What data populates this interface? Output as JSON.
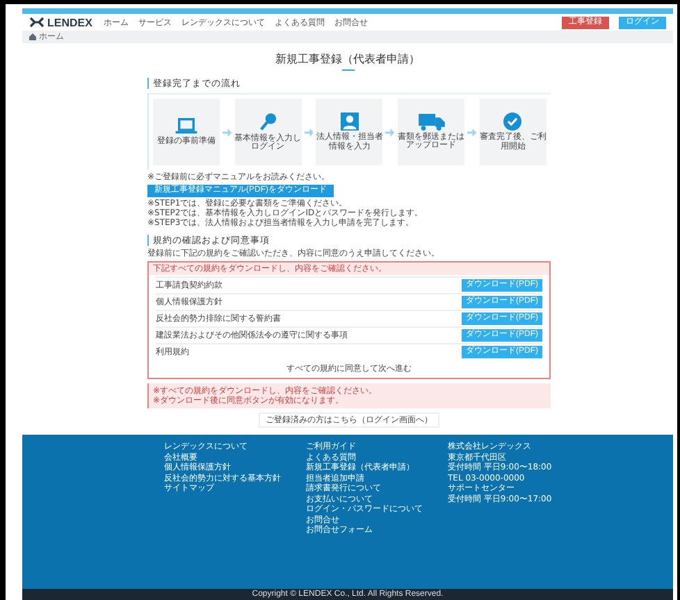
{
  "header": {
    "logo": "LENDEX",
    "nav": [
      "ホーム",
      "サービス",
      "レンデックスについて",
      "よくある質問",
      "お問合せ"
    ],
    "buttons": [
      {
        "label": "工事登録",
        "kind": "danger"
      },
      {
        "label": "ログイン",
        "kind": "primary"
      }
    ]
  },
  "breadcrumb": [
    "ホーム"
  ],
  "title": "新規工事登録（代表者申請）",
  "flow": {
    "heading": "登録完了までの流れ",
    "steps": [
      {
        "caption": "登録の事前準備"
      },
      {
        "caption": "基本情報を入力しログイン"
      },
      {
        "caption": "法人情報・担当者情報を入力"
      },
      {
        "caption": "書類を郵送またはアップロード"
      },
      {
        "caption": "審査完了後、ご利用開始"
      }
    ]
  },
  "manual": {
    "note": "※ご登録前に必ずマニュアルをお読みください。",
    "button": "新規工事登録マニュアル(PDF)をダウンロード",
    "lines": [
      "※STEP1では、登録に必要な書類をご準備ください。",
      "※STEP2では、基本情報を入力しログインIDとパスワードを発行します。",
      "※STEP3では、法人情報および担当者情報を入力し申請を完了します。"
    ]
  },
  "terms": {
    "heading": "規約の確認および同意事項",
    "description": "登録前に下記の規約をご確認いただき、内容に同意のうえ申請してください。",
    "alert": "下記すべての規約をダウンロードし、内容をご確認ください。",
    "rows": [
      {
        "label": "工事請負契約約款",
        "button": "ダウンロード(PDF)"
      },
      {
        "label": "個人情報保護方針",
        "button": "ダウンロード(PDF)"
      },
      {
        "label": "反社会的勢力排除に関する誓約書",
        "button": "ダウンロード(PDF)"
      },
      {
        "label": "建設業法およびその他関係法令の遵守に関する事項",
        "button": "ダウンロード(PDF)"
      },
      {
        "label": "利用規約",
        "button": "ダウンロード(PDF)"
      }
    ],
    "agree": "すべての規約に同意して次へ進む"
  },
  "notice": [
    "※すべての規約をダウンロードし、内容をご確認ください。",
    "※ダウンロード後に同意ボタンが有効になります。"
  ],
  "login_link": "ご登録済みの方はこちら（ログイン画面へ）",
  "footer": {
    "columns": [
      [
        "レンデックスについて",
        "会社概要",
        "個人情報保護方針",
        "反社会的勢力に対する基本方針",
        "サイトマップ"
      ],
      [
        "ご利用ガイド",
        "よくある質問",
        "新規工事登録（代表者申請）",
        "担当者追加申請",
        "請求書発行について",
        "お支払いについて",
        "ログイン・パスワードについて",
        "お問合せ",
        "お問合せフォーム"
      ],
      [
        "株式会社レンデックス",
        "東京都千代田区",
        "受付時間 平日9:00〜18:00",
        "TEL 03-0000-0000",
        "サポートセンター",
        "受付時間 平日9:00〜17:00"
      ]
    ],
    "copyright": "Copyright © LENDEX Co., Ltd. All Rights Reserved."
  }
}
